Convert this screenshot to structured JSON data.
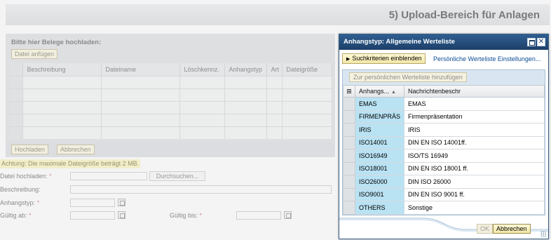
{
  "page": {
    "title": "5) Upload-Bereich für Anlagen",
    "upload_prompt": "Bitte hier Belege hochladen:",
    "attach_button": "Datei anfügen",
    "columns": [
      "Beschreibung",
      "Dateiname",
      "Löschkennz.",
      "Anhangstyp",
      "Art",
      "Dateigröße"
    ],
    "upload_button": "Hochladen",
    "cancel_button": "Abbrechen",
    "warning": "Achtung: Die maximale Dateigröße beträgt 2 MB.",
    "form": {
      "file_label": "Datei hochladen:",
      "browse_button": "Durchsuchen...",
      "description_label": "Beschreibung:",
      "type_label": "Anhangstyp:",
      "valid_from_label": "Gültig ab:",
      "valid_to_label": "Gültig bis:",
      "required_mark": "*"
    }
  },
  "dialog": {
    "title": "Anhangstyp: Allgemeine Werteliste",
    "search_button": "Suchkriterien einblenden",
    "settings_link": "Persönliche Werteliste Einstellungen...",
    "add_button": "Zur persönlichen Werteliste hinzufügen",
    "col_key": "Anhangs...",
    "col_desc": "Nachrichtenbeschr",
    "rows": [
      {
        "key": "EMAS",
        "desc": "EMAS"
      },
      {
        "key": "FIRMENPRÄS",
        "desc": "Firmenpräsentation"
      },
      {
        "key": "IRIS",
        "desc": "IRIS"
      },
      {
        "key": "ISO14001",
        "desc": "DIN EN ISO 14001ff."
      },
      {
        "key": "ISO16949",
        "desc": "ISO/TS 16949"
      },
      {
        "key": "ISO18001",
        "desc": "DIN EN ISO 18001 ff."
      },
      {
        "key": "ISO26000",
        "desc": "DIN ISO 26000"
      },
      {
        "key": "ISO9001",
        "desc": "DIN EN ISO 9001 ff."
      },
      {
        "key": "OTHERS",
        "desc": "Sonstige"
      }
    ],
    "ok_button": "OK",
    "cancel_button": "Abbrechen"
  },
  "colors": {
    "dialog_title_bg": "#1d3f69",
    "key_cell_bg": "#b9e2f3",
    "button_yellow": "#f3e7a6",
    "link": "#0b4d94"
  }
}
